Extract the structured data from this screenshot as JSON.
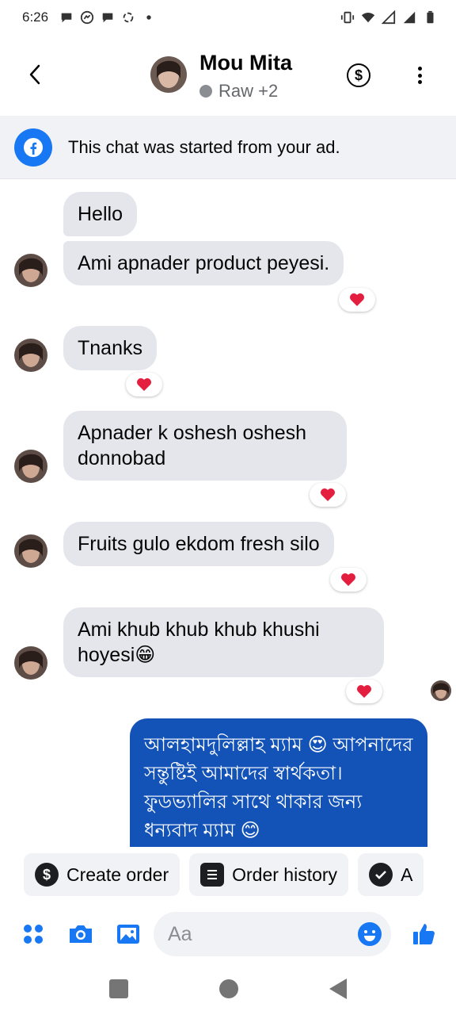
{
  "status_bar": {
    "time": "6:26"
  },
  "header": {
    "contact_name": "Mou Mita",
    "subtitle": "Raw +2"
  },
  "ad_banner": {
    "text": "This chat was started from your ad."
  },
  "messages": [
    {
      "text": "Hello",
      "reaction": "heart"
    },
    {
      "text": "Ami apnader product peyesi.",
      "reaction": "heart"
    },
    {
      "text": "Tnanks",
      "reaction": "heart"
    },
    {
      "text": "Apnader k oshesh oshesh donnobad",
      "reaction": "heart"
    },
    {
      "text": "Fruits gulo ekdom fresh silo",
      "reaction": "heart"
    },
    {
      "text": "Ami khub khub khub khushi hoyesi😁",
      "reaction": "heart"
    }
  ],
  "outgoing": {
    "text": "আলহামদুলিল্লাহ ম্যাম 😍 আপনাদের সন্তুষ্টিই আমাদের স্বার্থকতা। ফুডভ্যালির সাথে থাকার জন্য ধন্যবাদ ম্যাম 😊"
  },
  "quick_actions": [
    {
      "label": "Create order",
      "icon": "dollar-icon"
    },
    {
      "label": "Order history",
      "icon": "list-icon"
    },
    {
      "label": "A",
      "icon": "check-icon"
    }
  ],
  "composer": {
    "placeholder": "Aa"
  },
  "colors": {
    "accent": "#1877f2",
    "outgoing_bubble": "#1353b8",
    "incoming_bubble": "#e4e6eb",
    "reaction_heart": "#e41e3f"
  }
}
